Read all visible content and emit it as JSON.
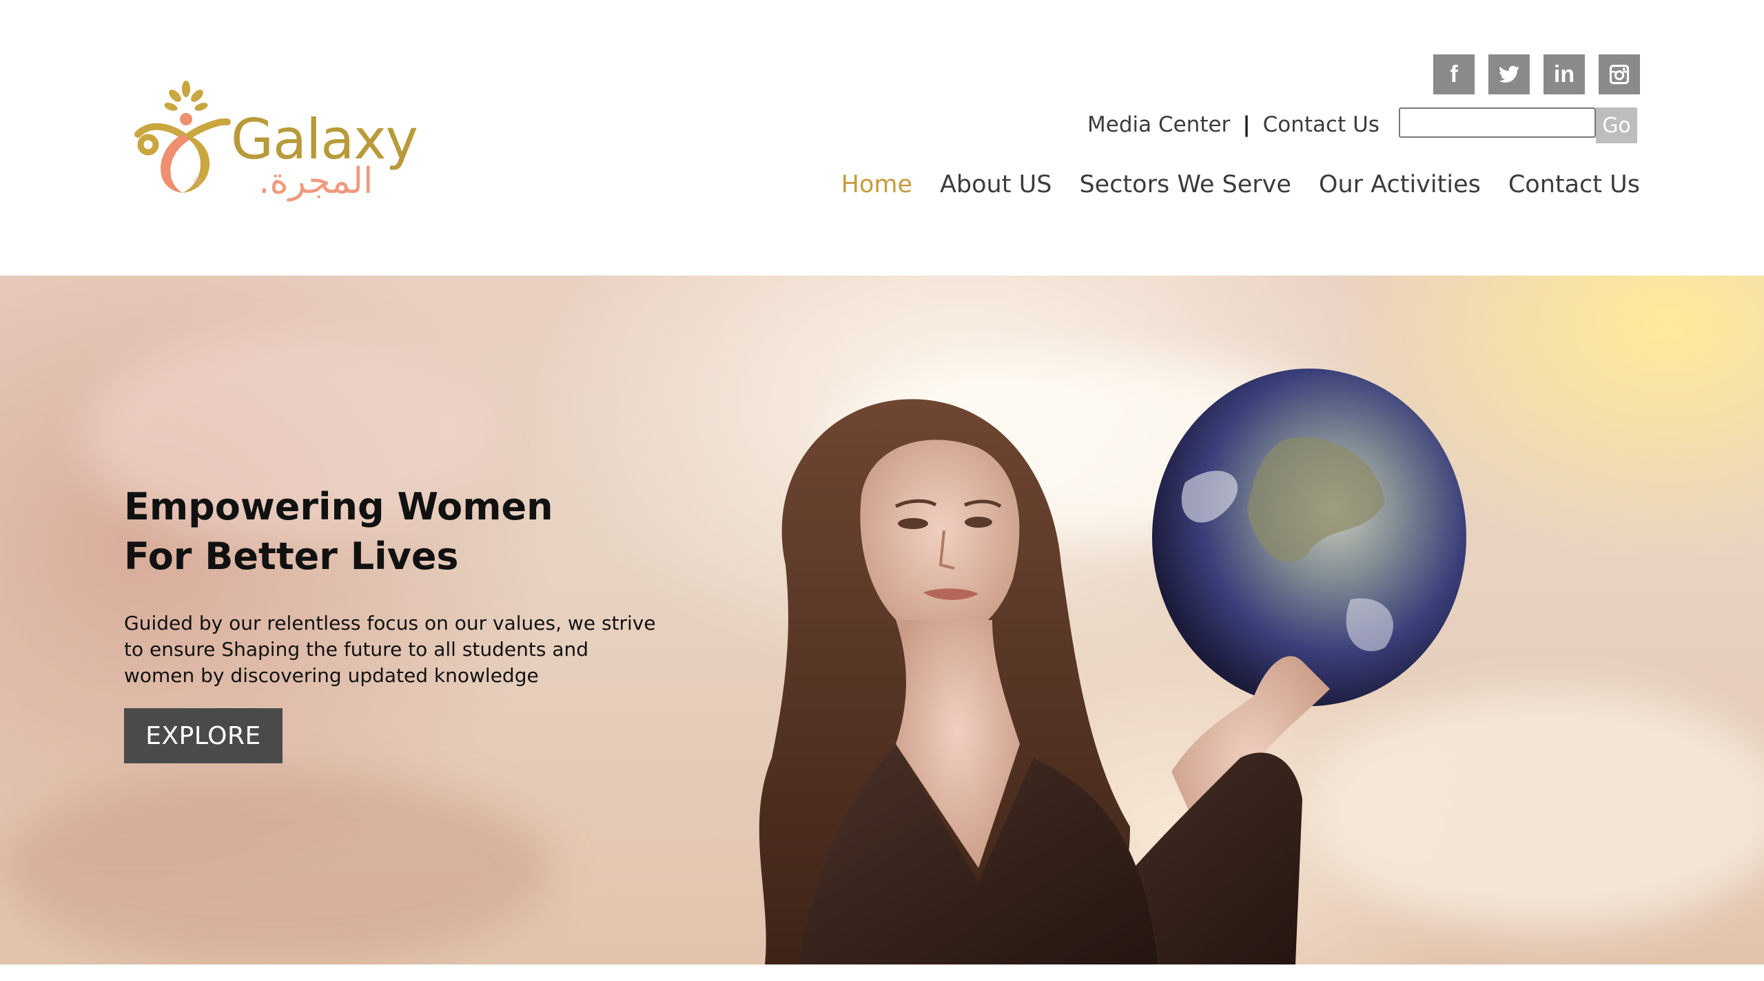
{
  "logo": {
    "wordmark": "Galaxy",
    "arabic": "المجرة.",
    "reg": "®"
  },
  "social": [
    {
      "icon": "facebook-icon",
      "label": "f"
    },
    {
      "icon": "twitter-icon",
      "label": ""
    },
    {
      "icon": "linkedin-icon",
      "label": "in"
    },
    {
      "icon": "instagram-icon",
      "label": ""
    }
  ],
  "toplinks": {
    "media_center": "Media Center",
    "separator": "|",
    "contact_us": "Contact Us"
  },
  "search": {
    "value": "",
    "go_label": "Go"
  },
  "nav": {
    "home": "Home",
    "about": "About US",
    "sectors": "Sectors We Serve",
    "activities": "Our Activities",
    "contact": "Contact Us"
  },
  "hero": {
    "title_line1": "Empowering Women",
    "title_line2": "For Better Lives",
    "text": "Guided by our relentless focus on our values, we strive to ensure Shaping the future to all students and women by discovering updated knowledge",
    "explore_label": "EXPLORE"
  },
  "colors": {
    "accent": "#c79a3c",
    "logo_gold": "#b89a3a",
    "logo_peach": "#ef9a7d",
    "social_bg": "#8a8a8a",
    "button_dark": "#4a4a4a"
  }
}
